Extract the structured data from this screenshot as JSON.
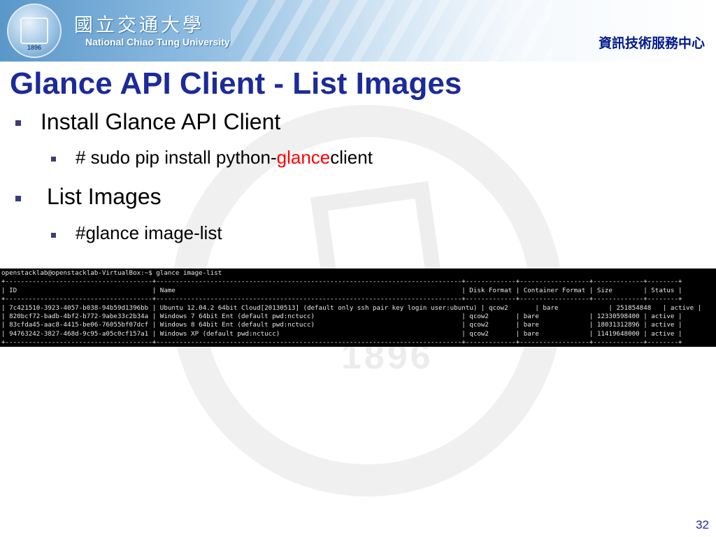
{
  "header": {
    "university_cn": "國立交通大學",
    "university_en": "National Chiao Tung University",
    "department": "資訊技術服務中心",
    "seal_year": "1896"
  },
  "slide": {
    "title": "Glance API Client - List Images",
    "page_number": "32",
    "bullets": [
      {
        "text": "Install Glance API Client",
        "sub": {
          "prefix": "# sudo pip install python-",
          "highlight": "glance",
          "suffix": "client"
        }
      },
      {
        "text": "List Images",
        "sub": {
          "text": "#glance image-list"
        }
      }
    ]
  },
  "terminal": {
    "lines": [
      "openstacklab@openstacklab-VirtualBox:~$ glance image-list",
      "+--------------------------------------+-------------------------------------------------------------------------------+-------------+------------------+-------------+--------+",
      "| ID                                   | Name                                                                          | Disk Format | Container Format | Size        | Status |",
      "+--------------------------------------+-------------------------------------------------------------------------------+-------------+------------------+-------------+--------+",
      "| 7c421510-3923-4057-b038-94b59d1396bb | Ubuntu 12.04.2 64bit Cloud[20130513] (default only ssh pair key login user:ubuntu) | qcow2       | bare             | 251854848   | active |",
      "| 820bcf72-badb-4bf2-b772-9abe33c2b34a | Windows 7 64bit Ent (default pwd:nctucc)                                      | qcow2       | bare             | 12330598400 | active |",
      "| 83cfda45-aac8-4415-be06-76055bf07dcf | Windows 8 64bit Ent (default pwd:nctucc)                                      | qcow2       | bare             | 18031312896 | active |",
      "| 94763242-3827-468d-9c95-a05c0cf157a1 | Windows XP (default pwd:nctucc)                                               | qcow2       | bare             | 11419648000 | active |",
      "+--------------------------------------+-------------------------------------------------------------------------------+-------------+------------------+-------------+--------+"
    ]
  }
}
